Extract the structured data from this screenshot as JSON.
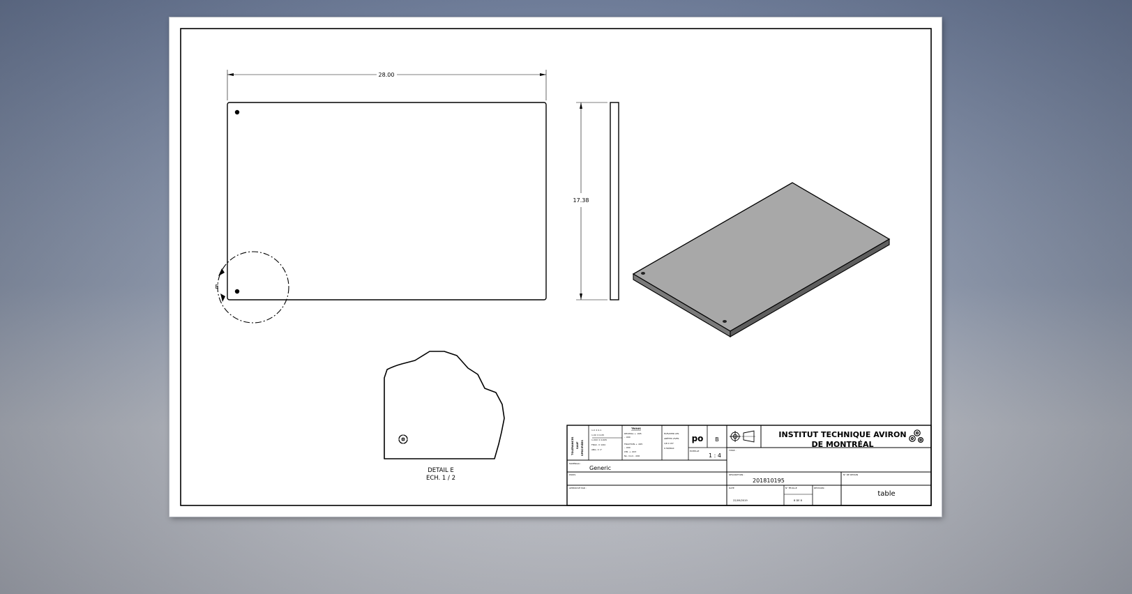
{
  "drawing": {
    "dimension_width": "28.00",
    "dimension_height": "17.38",
    "detail_marker": "E",
    "detail_caption_line1": "DETAIL  E",
    "detail_caption_line2": "ECH. 1 / 2"
  },
  "title_block": {
    "tolerances_vertical": "TOLÉRANCES",
    "tolerances_vertical2": "SAUF",
    "tolerances_vertical3": "SPECIFIÉES",
    "tol_rows": [
      "1.X     ± 0.1",
      "1.XX    ± 0.05",
      "1.XXX   ± 0.005",
      "FRAC.   ± 1/64",
      "ANG.    ± 1°"
    ],
    "trous_title": "TROUS",
    "trous_rows": [
      "DECIMAL   + .005",
      "              - .000",
      "FRACTION  + .005",
      "              - .000",
      "LTR.      + .003",
      "No. mod   - .000"
    ],
    "finish_rows": [
      "ÉLÉVATER LES",
      "ARÊTES VIVES",
      "1/8 X 45°",
      "0.5R/MAX"
    ],
    "drawn_by": "po",
    "revision_letter": "B",
    "scale_label": "ECHELLE",
    "scale_value": "1 : 4",
    "company_line1": "INSTITUT TECHNIQUE AVIRON",
    "company_line2": "DE MONTRÉAL",
    "title_label": "TITRE :",
    "material_label": "MATÉRIAU :",
    "material_value": "Generic",
    "poids_label": "POIDS",
    "apprimage_label": "APPROUVÉ PAR :",
    "description_label": "DESCRIPTION :",
    "description_value": "201810195",
    "drawing_no_label": "N° DE DESSIN",
    "drawing_no_value": "table",
    "date_label": "DATE",
    "date_value": "22/09/2019",
    "sheet_label": "N° FEUILLE",
    "sheet_value": "8 DE 8",
    "revision_label": "RÉVISION :"
  }
}
